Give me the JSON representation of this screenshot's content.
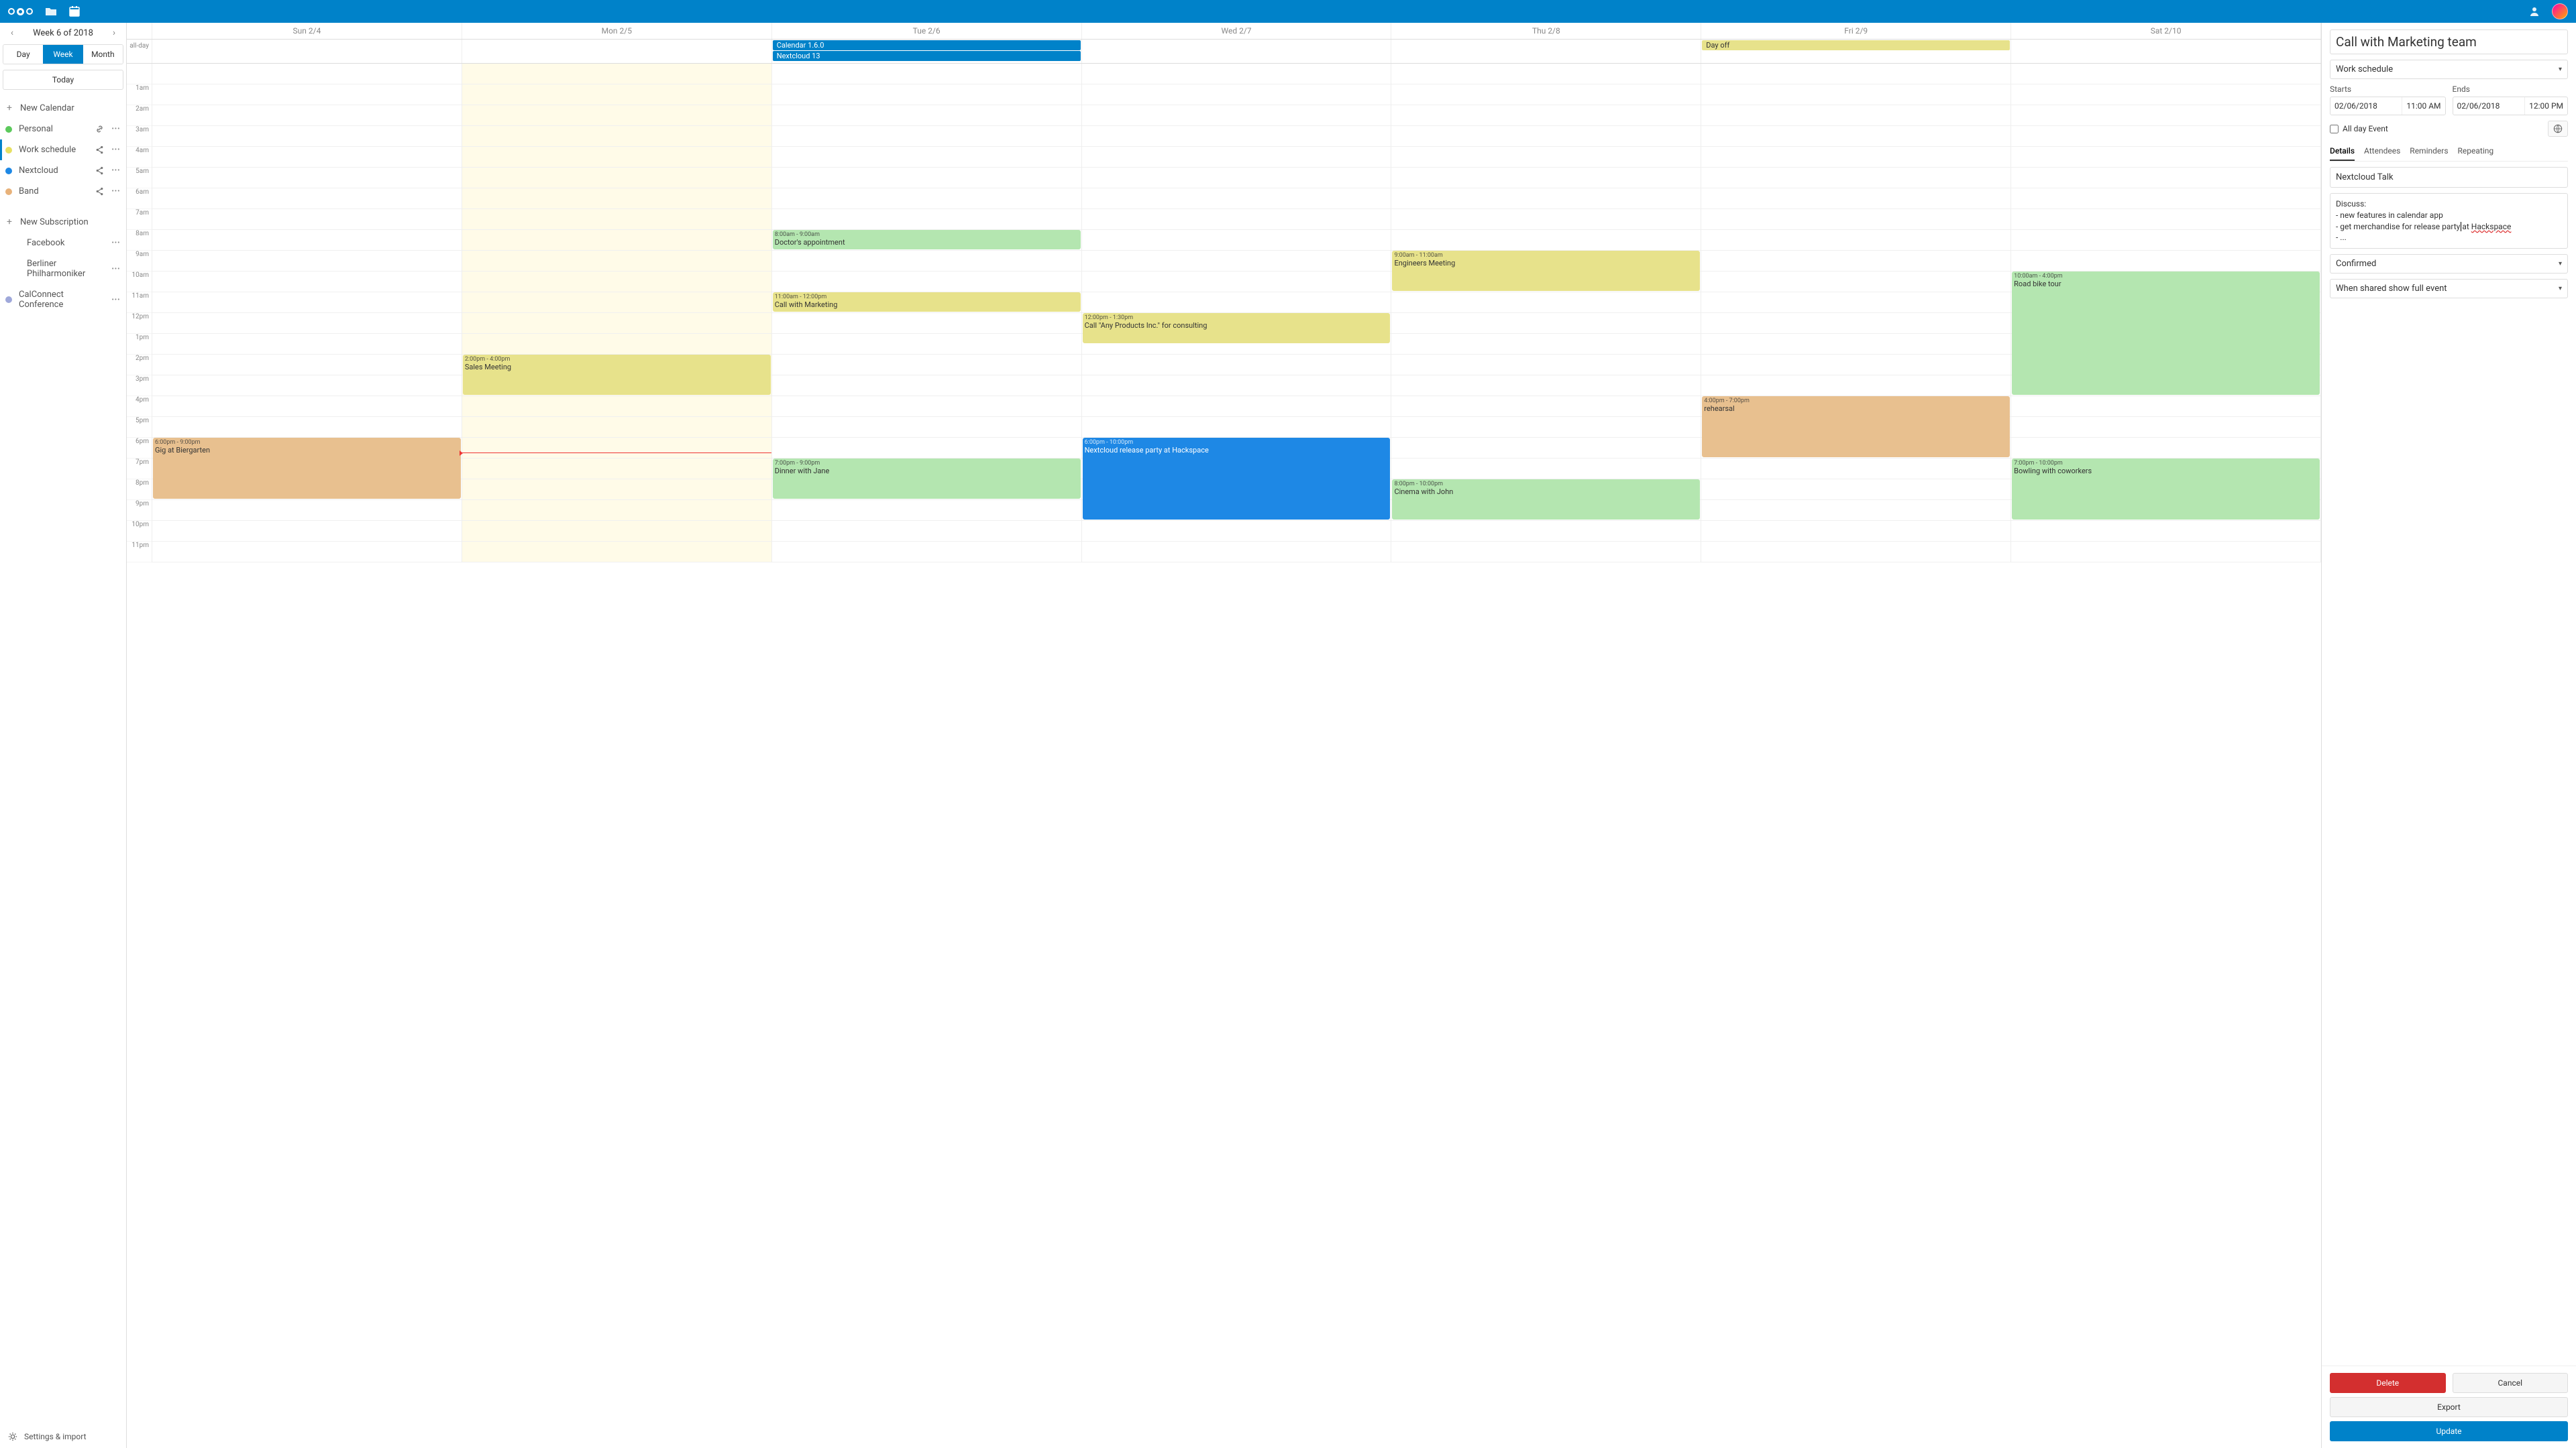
{
  "nav_title": "Week 6 of 2018",
  "view_tabs": {
    "day": "Day",
    "week": "Week",
    "month": "Month"
  },
  "today_btn": "Today",
  "new_calendar": "New Calendar",
  "new_subscription": "New Subscription",
  "calendars": [
    {
      "name": "Personal",
      "color": "#5cc95c",
      "icon": "link"
    },
    {
      "name": "Work schedule",
      "color": "#e7e061",
      "icon": "share"
    },
    {
      "name": "Nextcloud",
      "color": "#1e88e5",
      "icon": "share"
    },
    {
      "name": "Band",
      "color": "#e8b27a",
      "icon": "share"
    }
  ],
  "subscriptions": [
    {
      "name": "Facebook",
      "dot": ""
    },
    {
      "name": "Berliner Philharmoniker",
      "dot": ""
    },
    {
      "name": "CalConnect Conference",
      "dot": "#9fa8da"
    }
  ],
  "settings_import": "Settings & import",
  "day_headers": [
    "Sun 2/4",
    "Mon 2/5",
    "Tue 2/6",
    "Wed 2/7",
    "Thu 2/8",
    "Fri 2/9",
    "Sat 2/10"
  ],
  "allday_label": "all-day",
  "allday_events": {
    "2": [
      {
        "title": "Calendar 1.6.0",
        "cls": "blue"
      },
      {
        "title": "Nextcloud 13",
        "cls": "blue"
      }
    ],
    "5": [
      {
        "title": "Day off",
        "cls": "yellow"
      }
    ]
  },
  "hour_labels": [
    "1am",
    "2am",
    "3am",
    "4am",
    "5am",
    "6am",
    "7am",
    "8am",
    "9am",
    "10am",
    "11am",
    "12pm",
    "1pm",
    "2pm",
    "3pm",
    "4pm",
    "5pm",
    "6pm",
    "7pm",
    "8pm",
    "9pm",
    "10pm",
    "11pm"
  ],
  "events": [
    {
      "day": 0,
      "start": 18,
      "end": 21,
      "cls": "ev-orange",
      "time": "6:00pm - 9:00pm",
      "title": "Gig at Biergarten"
    },
    {
      "day": 1,
      "start": 14,
      "end": 16,
      "cls": "ev-yellow",
      "time": "2:00pm - 4:00pm",
      "title": "Sales Meeting"
    },
    {
      "day": 2,
      "start": 8,
      "end": 9,
      "cls": "ev-green",
      "time": "8:00am - 9:00am",
      "title": "Doctor's appointment"
    },
    {
      "day": 2,
      "start": 11,
      "end": 12,
      "cls": "ev-yellow",
      "time": "11:00am - 12:00pm",
      "title": "Call with Marketing"
    },
    {
      "day": 2,
      "start": 19,
      "end": 21,
      "cls": "ev-green",
      "time": "7:00pm - 9:00pm",
      "title": "Dinner with Jane"
    },
    {
      "day": 3,
      "start": 12,
      "end": 13.5,
      "cls": "ev-yellow",
      "time": "12:00pm - 1:30pm",
      "title": "Call \"Any Products Inc.\" for consulting"
    },
    {
      "day": 3,
      "start": 18,
      "end": 22,
      "cls": "ev-blue",
      "time": "6:00pm - 10:00pm",
      "title": "Nextcloud release party at Hackspace"
    },
    {
      "day": 4,
      "start": 9,
      "end": 11,
      "cls": "ev-yellow",
      "time": "9:00am - 11:00am",
      "title": "Engineers Meeting"
    },
    {
      "day": 4,
      "start": 20,
      "end": 22,
      "cls": "ev-green",
      "time": "8:00pm - 10:00pm",
      "title": "Cinema with John"
    },
    {
      "day": 5,
      "start": 16,
      "end": 19,
      "cls": "ev-orange",
      "time": "4:00pm - 7:00pm",
      "title": "rehearsal"
    },
    {
      "day": 6,
      "start": 10,
      "end": 16,
      "cls": "ev-green",
      "time": "10:00am - 4:00pm",
      "title": "Road bike tour"
    },
    {
      "day": 6,
      "start": 19,
      "end": 22,
      "cls": "ev-green",
      "time": "7:00pm - 10:00pm",
      "title": "Bowling with coworkers"
    }
  ],
  "today_col": 1,
  "now_hour": 18.7,
  "event_panel": {
    "title": "Call with Marketing team",
    "calendar_selected": "Work schedule",
    "starts_label": "Starts",
    "ends_label": "Ends",
    "start_date": "02/06/2018",
    "start_time": "11:00 AM",
    "end_date": "02/06/2018",
    "end_time": "12:00 PM",
    "allday_label": "All day Event",
    "tabs": {
      "details": "Details",
      "attendees": "Attendees",
      "reminders": "Reminders",
      "repeating": "Repeating"
    },
    "location": "Nextcloud Talk",
    "description_pre": "Discuss:\n- new features in calendar app\n- get merchandise for release party|at ",
    "description_misspell": "Hackspace",
    "description_post": "\n- ...",
    "status": "Confirmed",
    "visibility": "When shared show full event",
    "delete": "Delete",
    "cancel": "Cancel",
    "export": "Export",
    "update": "Update"
  }
}
